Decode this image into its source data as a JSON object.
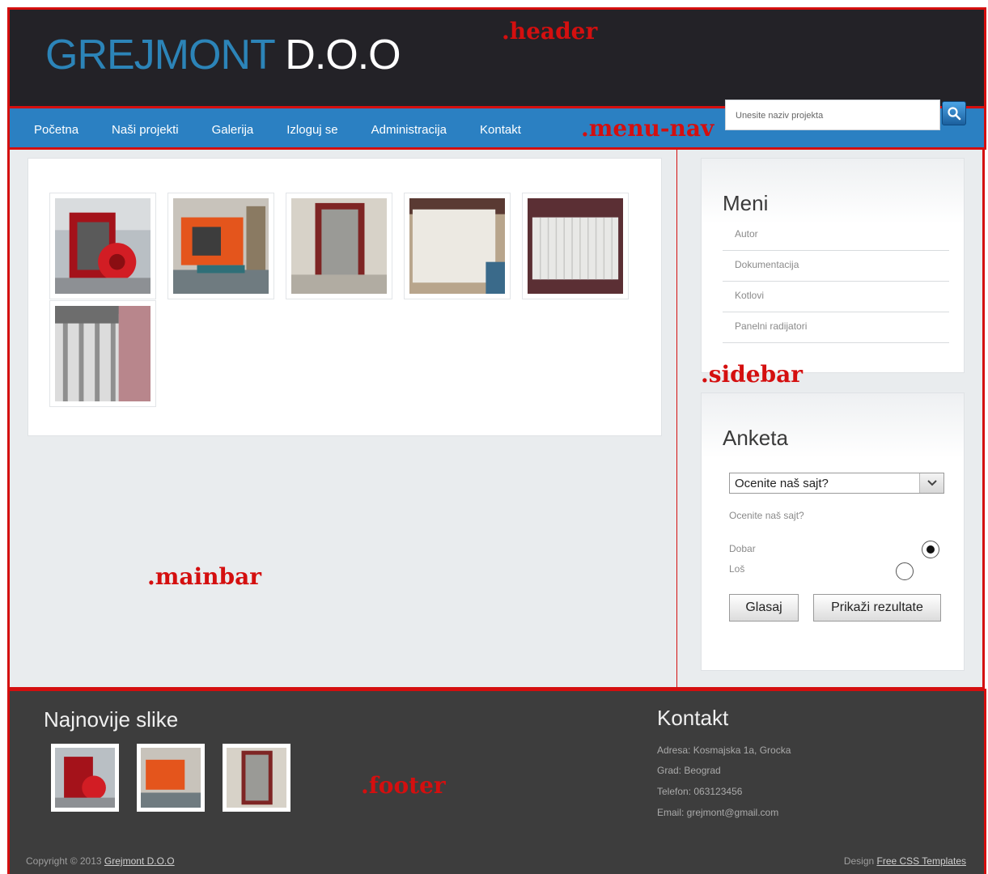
{
  "header": {
    "logo_part1": "GREJMONT",
    "logo_part2": " D.O.O",
    "region_label": ".header"
  },
  "menu": {
    "items": [
      "Početna",
      "Naši projekti",
      "Galerija",
      "Izloguj se",
      "Administracija",
      "Kontakt"
    ],
    "region_label": ".menu-nav",
    "search_placeholder": "Unesite naziv projekta"
  },
  "mainbar": {
    "region_label": ".mainbar",
    "photos": [
      "boiler-red",
      "boiler-orange",
      "doorframe",
      "panel-radiator",
      "radiator-white",
      "radiator-closeup"
    ]
  },
  "sidebar": {
    "region_label": ".sidebar",
    "menu_title": "Meni",
    "menu_links": [
      "Autor",
      "Dokumentacija",
      "Kotlovi",
      "Panelni radijatori"
    ],
    "poll_title": "Anketa",
    "poll_select": "Ocenite naš sajt?",
    "poll_question": "Ocenite naš sajt?",
    "option_good": "Dobar",
    "option_bad": "Loš",
    "vote_button": "Glasaj",
    "results_button": "Prikaži rezultate"
  },
  "footer": {
    "region_label": ".footer",
    "latest_title": "Najnovije slike",
    "contact_title": "Kontakt",
    "contact_lines": [
      "Adresa: Kosmajska 1a, Grocka",
      "Grad: Beograd",
      "Telefon: 063123456",
      "Email: grejmont@gmail.com"
    ],
    "copyright_prefix": "Copyright © 2013 ",
    "copyright_link": "Grejmont D.O.O",
    "design_prefix": "Design ",
    "design_link": "Free CSS Templates"
  },
  "colors": {
    "accent": "#2b80c2",
    "region_border": "#d40f0f",
    "header_bg": "#232227",
    "footer_bg": "#3d3d3d"
  }
}
